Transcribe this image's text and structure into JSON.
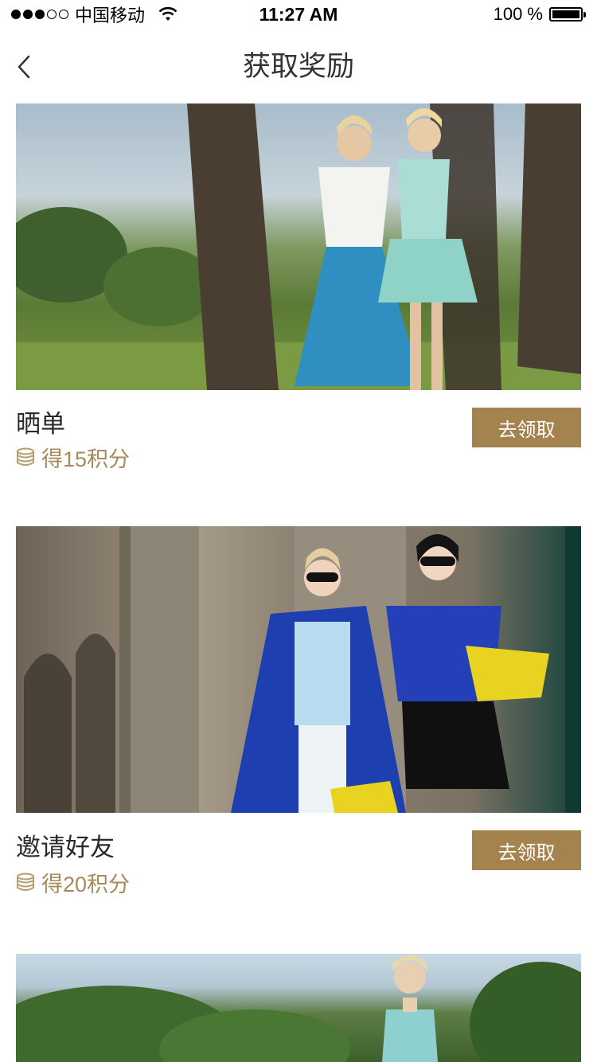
{
  "status_bar": {
    "carrier": "中国移动",
    "time": "11:27 AM",
    "battery": "100 %"
  },
  "nav": {
    "title": "获取奖励",
    "back_icon": "chevron-left-icon"
  },
  "rewards": [
    {
      "title": "晒单",
      "points": "得15积分",
      "button": "去领取"
    },
    {
      "title": "邀请好友",
      "points": "得20积分",
      "button": "去领取"
    }
  ],
  "colors": {
    "accent": "#a4834e",
    "points_text": "#a68a5a"
  }
}
